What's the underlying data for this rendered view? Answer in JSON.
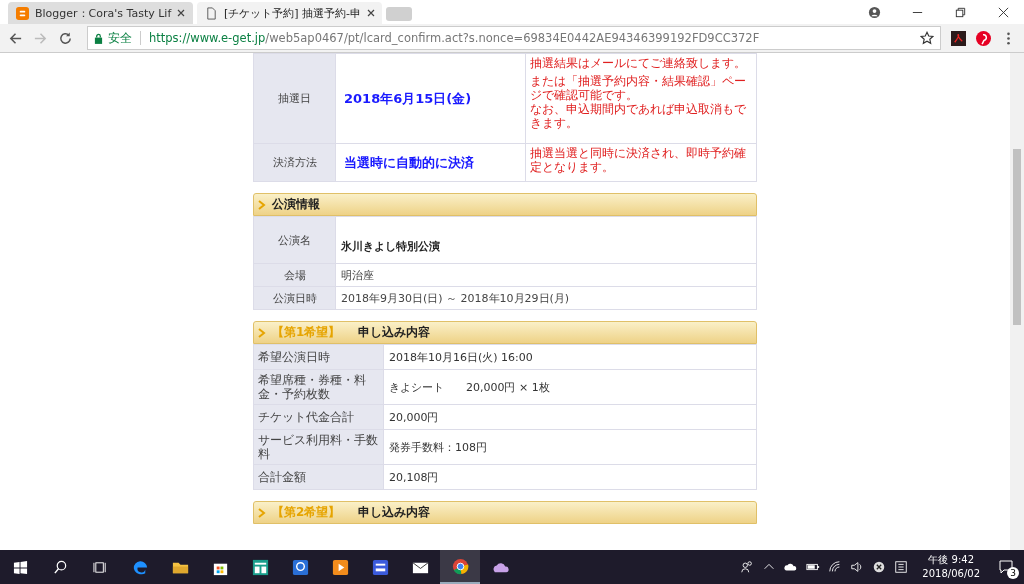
{
  "tabs": [
    {
      "title": "Blogger：Cora's Tasty Lif",
      "selected": false
    },
    {
      "title": "[チケット予約] 抽選予約-申",
      "selected": true
    }
  ],
  "address_bar": {
    "secure_label": "安全",
    "url_host": "https://www.e-get.jp",
    "url_path": "/web5ap0467/pt/lcard_confirm.act?s.nonce=69834E0442AE94346399192FD9CC372F"
  },
  "lottery_table": {
    "rows": [
      {
        "label": "抽選日",
        "value": "2018年6月15日(金)",
        "notes": [
          [
            "抽選結果はメールにてご連絡致します。"
          ],
          [
            "または「抽選予約内容・結果確認」ページで確認可能です。",
            "なお、申込期間内であれば申込取消もできます。"
          ]
        ]
      },
      {
        "label": "決済方法",
        "value": "当選時に自動的に決済",
        "notes": [
          [
            "抽選当選と同時に決済され、即時予約確定となります。"
          ]
        ]
      }
    ]
  },
  "performance_section": {
    "heading": "公演情報",
    "rows": [
      {
        "label": "公演名",
        "value": "氷川きよし特別公演",
        "kind": "title"
      },
      {
        "label": "会場",
        "value": "明治座",
        "kind": "plain"
      },
      {
        "label": "公演日時",
        "value": "2018年9月30日(日) ～ 2018年10月29日(月)",
        "kind": "plain"
      }
    ]
  },
  "choice_sections": [
    {
      "tag": "【第1希望】",
      "heading": "申し込み内容",
      "rows": [
        {
          "label": "希望公演日時",
          "value": "2018年10月16日(火) 16:00"
        },
        {
          "label": "希望席種・券種・料金・予約枚数",
          "value": "きよシート　　20,000円 × 1枚"
        },
        {
          "label": "チケット代金合計",
          "value": "20,000円"
        },
        {
          "label": "サービス利用料・手数料",
          "value": "発券手数料：108円"
        },
        {
          "label": "合計金額",
          "value": "20,108円"
        }
      ]
    },
    {
      "tag": "【第2希望】",
      "heading": "申し込み内容"
    }
  ],
  "taskbar": {
    "time": "午後 9:42",
    "date": "2018/06/02",
    "notification_count": "3"
  }
}
